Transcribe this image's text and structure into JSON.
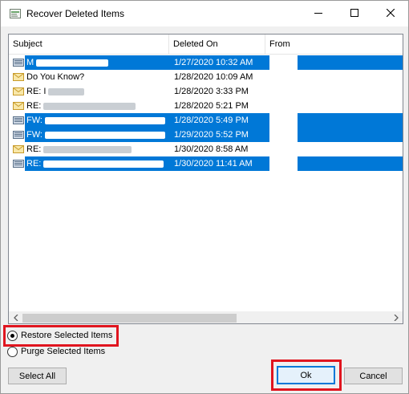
{
  "window": {
    "title": "Recover Deleted Items"
  },
  "columns": {
    "subject": "Subject",
    "deleted_on": "Deleted On",
    "from": "From"
  },
  "rows": [
    {
      "subject": "M",
      "deleted_on": "1/27/2020 10:32 AM",
      "selected": true
    },
    {
      "subject": "Do You Know?",
      "deleted_on": "1/28/2020 10:09 AM",
      "selected": false
    },
    {
      "subject": "RE: I",
      "deleted_on": "1/28/2020 3:33 PM",
      "selected": false
    },
    {
      "subject": "RE:",
      "deleted_on": "1/28/2020 5:21 PM",
      "selected": false
    },
    {
      "subject": "FW:",
      "deleted_on": "1/28/2020 5:49 PM",
      "selected": true
    },
    {
      "subject": "FW:",
      "deleted_on": "1/29/2020 5:52 PM",
      "selected": true
    },
    {
      "subject": "RE:",
      "deleted_on": "1/30/2020 8:58 AM",
      "selected": false
    },
    {
      "subject": "RE:",
      "deleted_on": "1/30/2020 11:41 AM",
      "selected": true
    }
  ],
  "options": {
    "restore_label": "Restore Selected Items",
    "purge_label": "Purge Selected Items",
    "selected": "restore"
  },
  "buttons": {
    "select_all": "Select All",
    "ok": "Ok",
    "cancel": "Cancel"
  },
  "colors": {
    "selection": "#0078d7",
    "highlight": "#e0151f"
  },
  "icons": {
    "app": "recover-items-icon",
    "mail": "envelope-icon"
  }
}
